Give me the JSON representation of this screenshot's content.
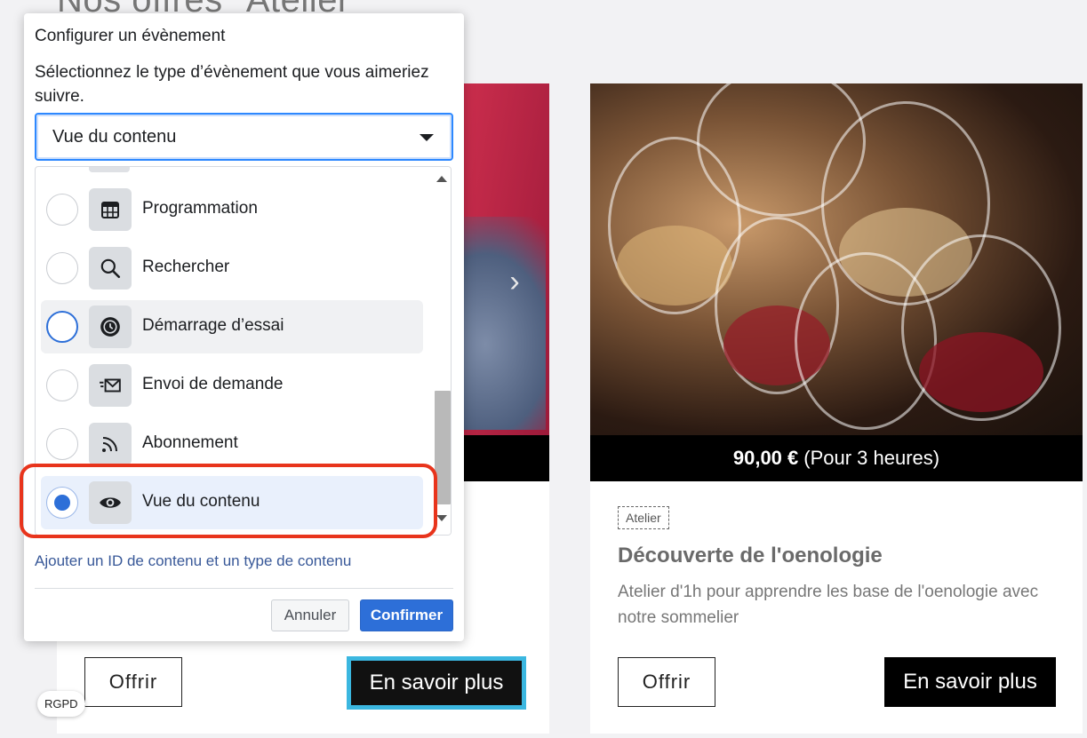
{
  "page": {
    "title": "Nos offres \"Atelier\"",
    "rgpd_label": "RGPD"
  },
  "left_card": {
    "offrir_label": "Offrir",
    "more_label": "En savoir plus",
    "next_glyph": "›"
  },
  "right_card": {
    "price_bold": "90,00 €",
    "price_suffix": "(Pour 3 heures)",
    "tag": "Atelier",
    "title": "Découverte de l'oenologie",
    "description": "Atelier d'1h pour apprendre les base de l'oenologie avec notre sommelier",
    "offrir_label": "Offrir",
    "more_label": "En savoir plus"
  },
  "dialog": {
    "title": "Configurer un évènement",
    "subtitle": "Sélectionnez le type d’évènement que vous aimeriez suivre.",
    "select_value": "Vue du contenu",
    "items": [
      {
        "label": "Programmation",
        "icon": "calendar-icon",
        "state": "default"
      },
      {
        "label": "Rechercher",
        "icon": "search-icon",
        "state": "default"
      },
      {
        "label": "Démarrage d’essai",
        "icon": "clock-icon",
        "state": "hover"
      },
      {
        "label": "Envoi de demande",
        "icon": "send-mail-icon",
        "state": "default"
      },
      {
        "label": "Abonnement",
        "icon": "rss-icon",
        "state": "default"
      },
      {
        "label": "Vue du contenu",
        "icon": "eye-icon",
        "state": "selected"
      }
    ],
    "add_link": "Ajouter un ID de contenu et un type de contenu",
    "cancel_label": "Annuler",
    "confirm_label": "Confirmer"
  },
  "colors": {
    "accent": "#2d6fd8",
    "annotation": "#e8341c",
    "highlight_outline": "#3bb7e0"
  }
}
